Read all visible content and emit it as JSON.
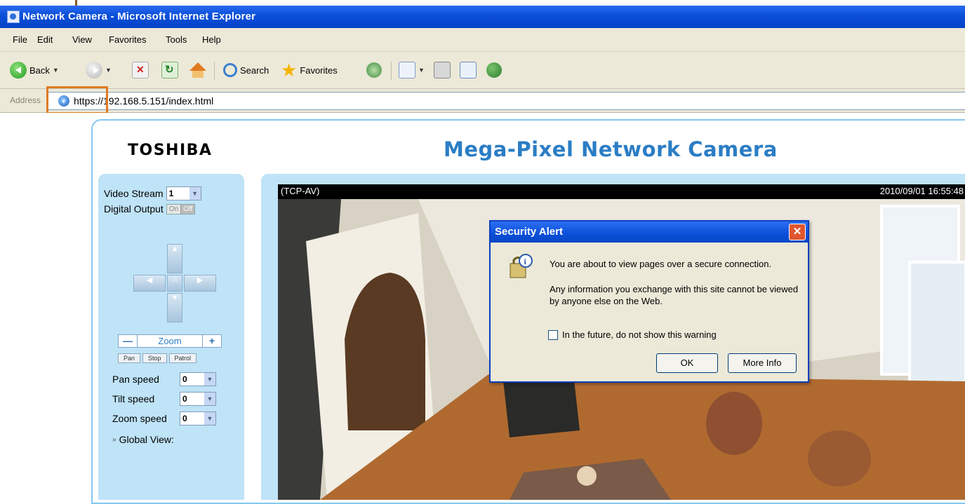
{
  "browser": {
    "title": "Network Camera - Microsoft Internet Explorer",
    "menu": [
      "File",
      "Edit",
      "View",
      "Favorites",
      "Tools",
      "Help"
    ],
    "toolbar": {
      "back_label": "Back",
      "search_label": "Search",
      "favorites_label": "Favorites"
    },
    "address_label": "Address",
    "address_value": "https://192.168.5.151/index.html"
  },
  "page": {
    "logo": "TOSHIBA",
    "title": "Mega-Pixel Network Camera",
    "controls": {
      "video_stream_label": "Video Stream",
      "video_stream_value": "1",
      "digital_output_label": "Digital Output",
      "digital_output_on": "On",
      "digital_output_off": "Off",
      "zoom_label": "Zoom",
      "zoom_minus": "—",
      "zoom_plus": "+",
      "pan_button": "Pan",
      "stop_button": "Stop",
      "patrol_button": "Patrol",
      "pan_speed_label": "Pan speed",
      "pan_speed_value": "0",
      "tilt_speed_label": "Tilt speed",
      "tilt_speed_value": "0",
      "zoom_speed_label": "Zoom speed",
      "zoom_speed_value": "0",
      "global_view_label": "Global View:"
    },
    "video": {
      "stream_mode": "(TCP-AV)",
      "timestamp": "2010/09/01 16:55:48"
    }
  },
  "dialog": {
    "title": "Security Alert",
    "line1": "You are about to view pages over a secure connection.",
    "line2": "Any information you exchange with this site cannot be viewed by anyone else on the Web.",
    "checkbox_label": "In the future, do not show this warning",
    "ok_button": "OK",
    "more_info_button": "More Info"
  }
}
